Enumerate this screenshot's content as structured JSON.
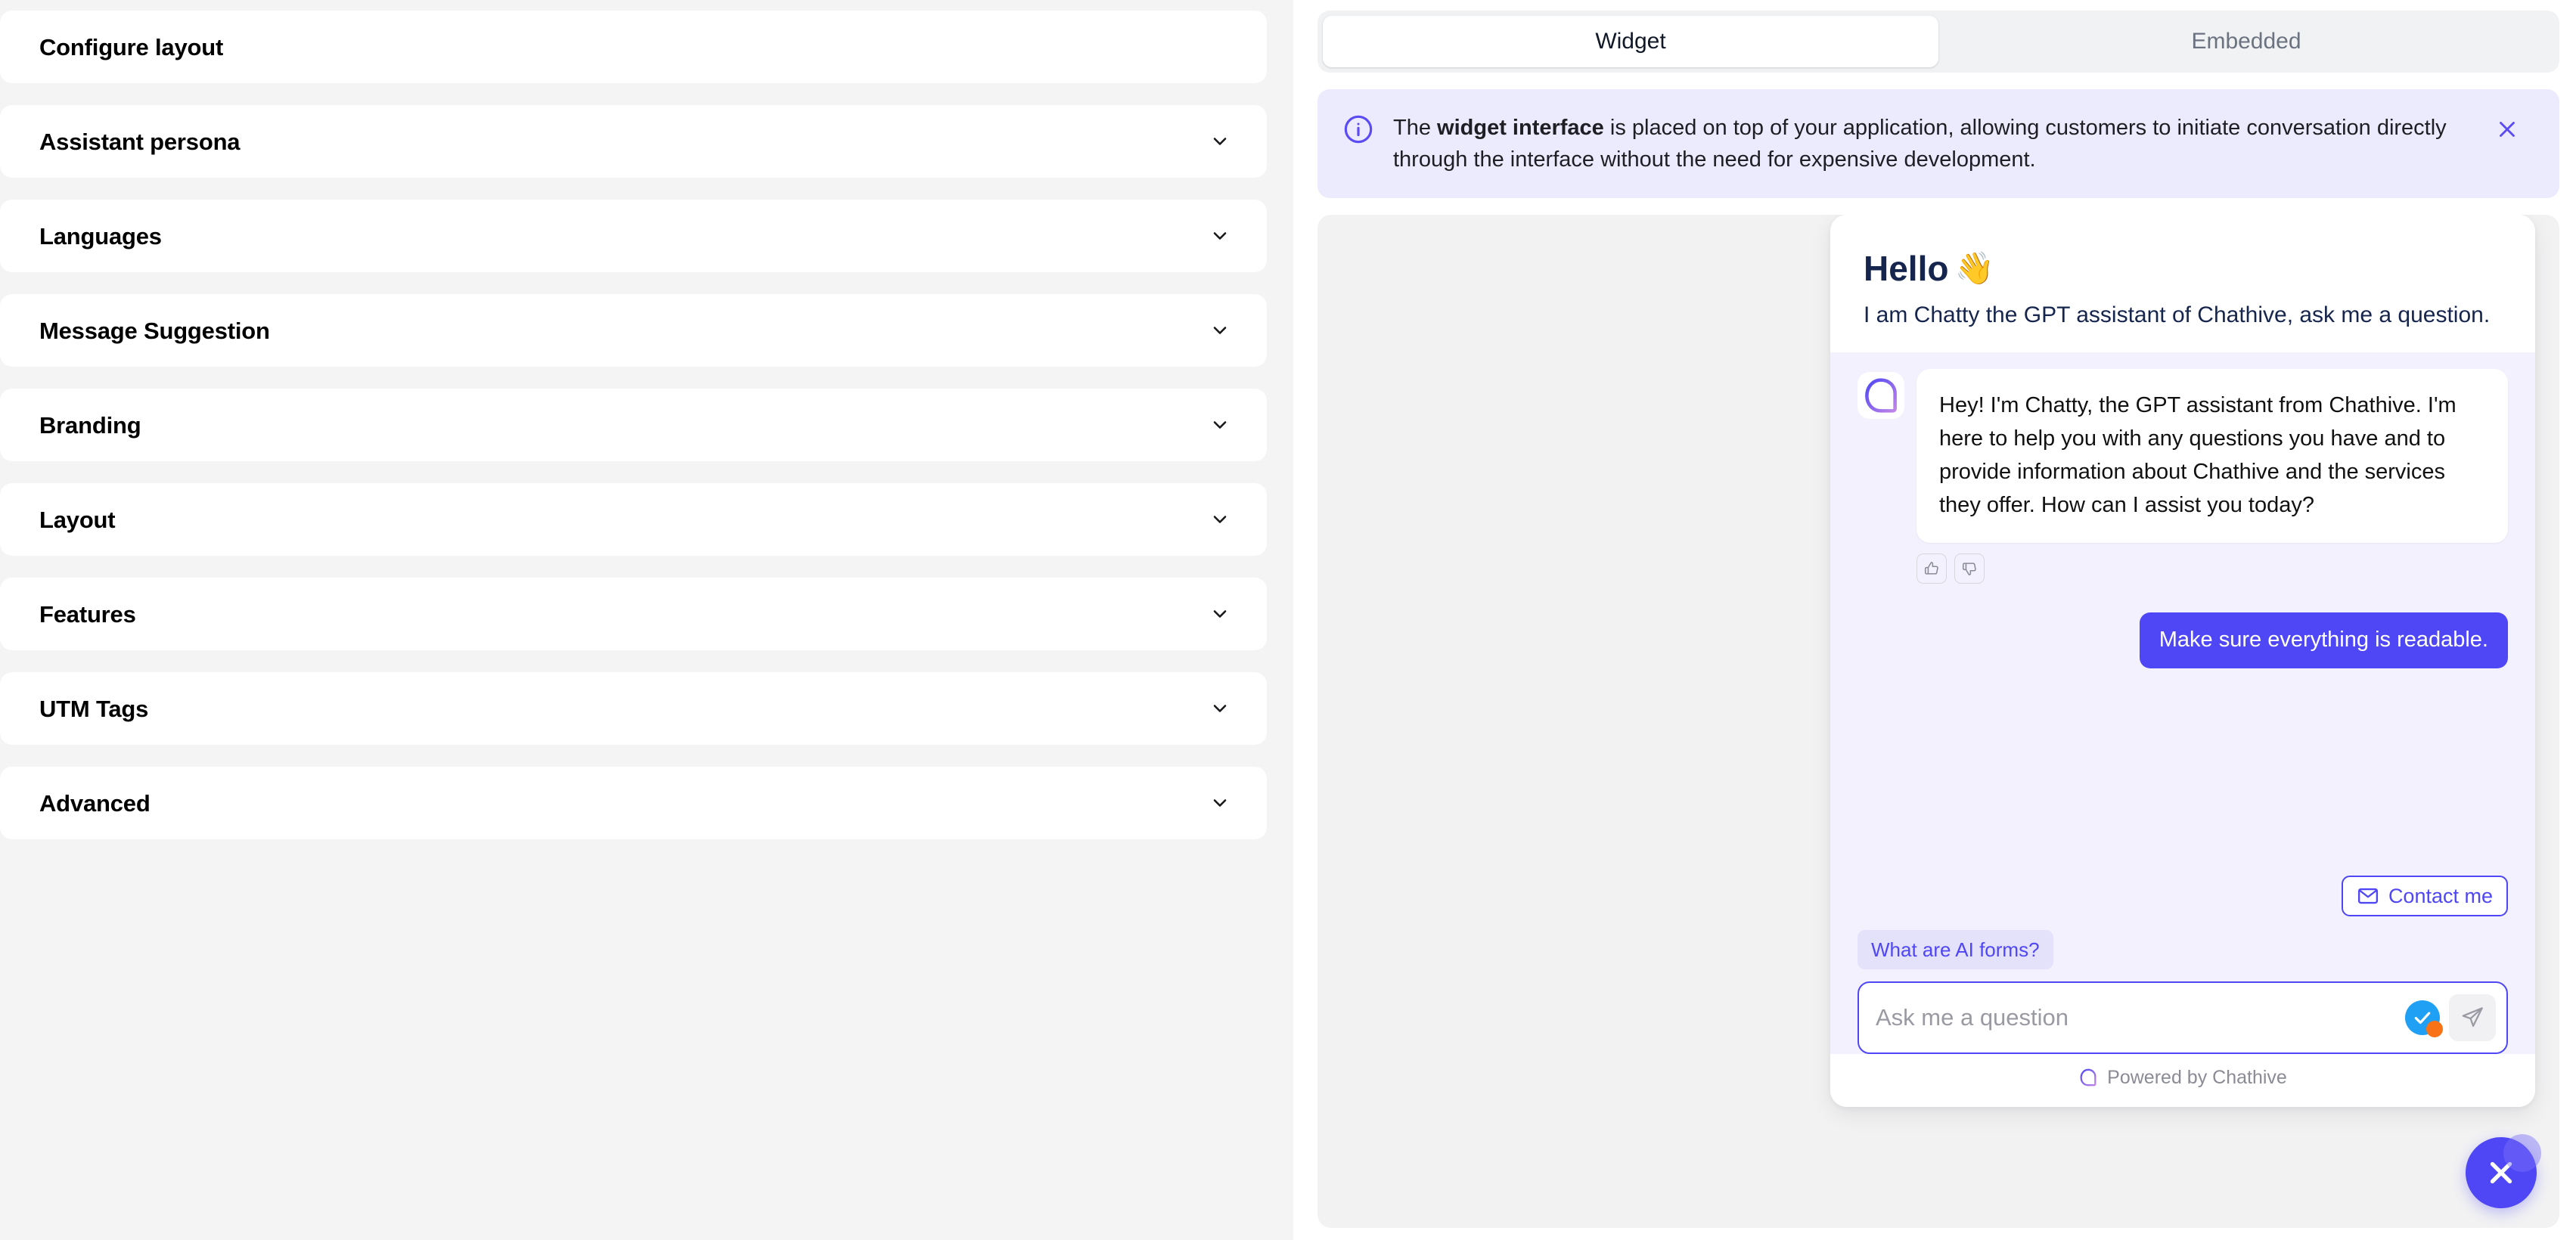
{
  "left_panel": {
    "sections": [
      {
        "label": "Configure layout",
        "expandable": false,
        "icon": ""
      },
      {
        "label": "Assistant persona",
        "expandable": true,
        "icon": "chevron-down-icon"
      },
      {
        "label": "Languages",
        "expandable": true,
        "icon": "chevron-down-icon"
      },
      {
        "label": "Message Suggestion",
        "expandable": true,
        "icon": "chevron-down-icon"
      },
      {
        "label": "Branding",
        "expandable": true,
        "icon": "chevron-down-icon"
      },
      {
        "label": "Layout",
        "expandable": true,
        "icon": "chevron-down-icon"
      },
      {
        "label": "Features",
        "expandable": true,
        "icon": "chevron-down-icon"
      },
      {
        "label": "UTM Tags",
        "expandable": true,
        "icon": "chevron-down-icon"
      },
      {
        "label": "Advanced",
        "expandable": true,
        "icon": "chevron-down-icon"
      }
    ]
  },
  "tabs": {
    "items": [
      {
        "label": "Widget",
        "active": true
      },
      {
        "label": "Embedded",
        "active": false
      }
    ]
  },
  "info_banner": {
    "icon": "info-circle-icon",
    "text_before": "The ",
    "text_bold": "widget interface",
    "text_after": " is placed on top of your application, allowing customers to initiate conversation directly through the interface without the need for expensive development.",
    "close_icon": "close-icon",
    "background_color": "#eceafd",
    "accent_color": "#5b4bf5"
  },
  "widget": {
    "greeting": "Hello",
    "greeting_emoji": "👋",
    "subtitle": "I am Chatty the GPT assistant of Chathive, ask me a question.",
    "avatar_icon": "chat-bubble-lines-icon",
    "messages": [
      {
        "role": "assistant",
        "text": "Hey! I'm Chatty, the GPT assistant from Chathive. I'm here to help you with any questions you have and to provide information about Chathive and the services they offer. How can I assist you today?"
      },
      {
        "role": "user",
        "text": "Make sure everything is readable."
      }
    ],
    "feedback": {
      "thumbs_up_icon": "thumbs-up-icon",
      "thumbs_down_icon": "thumbs-down-icon"
    },
    "contact_button": {
      "label": "Contact me",
      "icon": "envelope-icon"
    },
    "suggestions": [
      {
        "label": "What are AI forms?"
      }
    ],
    "composer": {
      "placeholder": "Ask me a question",
      "value": "",
      "grammar_icon": "grammarly-check-icon",
      "send_icon": "send-paper-plane-icon"
    },
    "footer": {
      "text": "Powered by Chathive",
      "icon": "chathive-logo-icon"
    },
    "accent_color": "#4f46f5",
    "body_background": "#f2f1fd"
  },
  "fab": {
    "icon": "close-x-icon",
    "color": "#4f46f5"
  }
}
